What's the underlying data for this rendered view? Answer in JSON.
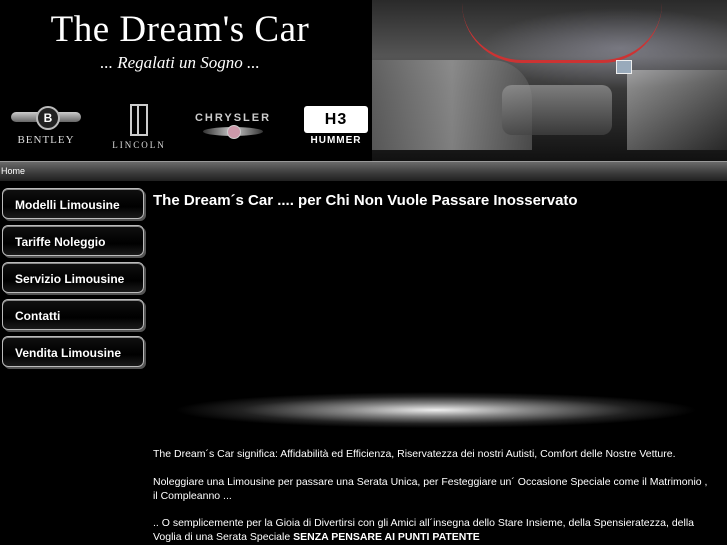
{
  "header": {
    "title": "The Dream's Car",
    "slogan": "... Regalati un Sogno ...",
    "logos": [
      {
        "name": "BENTLEY",
        "mark": "B"
      },
      {
        "name": "LINCOLN"
      },
      {
        "name": "CHRYSLER"
      },
      {
        "name": "HUMMER",
        "mark": "H3"
      }
    ]
  },
  "nav": {
    "home": "Home"
  },
  "sidebar": {
    "items": [
      {
        "label": "Modelli Limousine"
      },
      {
        "label": "Tariffe Noleggio"
      },
      {
        "label": "Servizio Limousine"
      },
      {
        "label": "Contatti"
      },
      {
        "label": "Vendita Limousine"
      }
    ]
  },
  "main": {
    "heading": "The Dream´s Car .... per Chi Non Vuole Passare Inosservato",
    "paragraphs": [
      "The Dream´s Car significa: Affidabilità ed Efficienza, Riservatezza dei nostri Autisti, Comfort delle Nostre Vetture.",
      "Noleggiare una Limousine per passare una Serata Unica, per Festeggiare un´ Occasione Speciale come il Matrimonio , il Compleanno ...",
      ".. O semplicemente per la Gioia di Divertirsi con gli Amici all´insegna dello Stare Insieme, della Spensieratezza, della Voglia di una Serata Speciale"
    ],
    "emphasis": "SENZA PENSARE AI PUNTI PATENTE"
  },
  "colors": {
    "background": "#000000",
    "text": "#ffffff",
    "accent": "#cc3333"
  }
}
